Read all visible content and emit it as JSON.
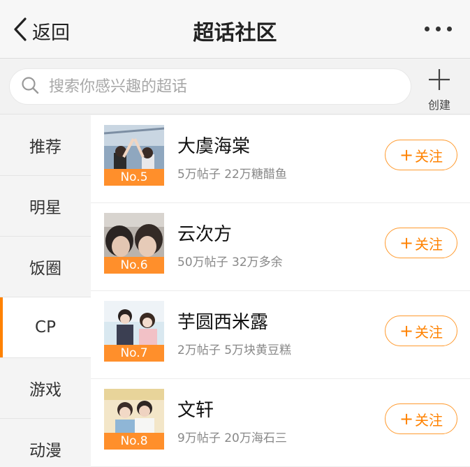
{
  "header": {
    "back_label": "返回",
    "title": "超话社区",
    "more_icon": "more-horizontal-icon"
  },
  "search": {
    "placeholder": "搜索你感兴趣的超话",
    "create_label": "创建"
  },
  "sidebar": {
    "items": [
      {
        "label": "推荐",
        "active": false
      },
      {
        "label": "明星",
        "active": false
      },
      {
        "label": "饭圈",
        "active": false
      },
      {
        "label": "CP",
        "active": true
      },
      {
        "label": "游戏",
        "active": false
      },
      {
        "label": "动漫",
        "active": false
      }
    ]
  },
  "list": {
    "follow_label": "关注",
    "items": [
      {
        "rank": "No.5",
        "name": "大虞海棠",
        "stats": "5万帖子 22万糖醋鱼"
      },
      {
        "rank": "No.6",
        "name": "云次方",
        "stats": "50万帖子 32万多余"
      },
      {
        "rank": "No.7",
        "name": "芋圆西米露",
        "stats": "2万帖子 5万块黄豆糕"
      },
      {
        "rank": "No.8",
        "name": "文轩",
        "stats": "9万帖子 20万海石三"
      }
    ]
  },
  "colors": {
    "accent": "#ff8200",
    "rank_bg": "#ff8f2b"
  }
}
